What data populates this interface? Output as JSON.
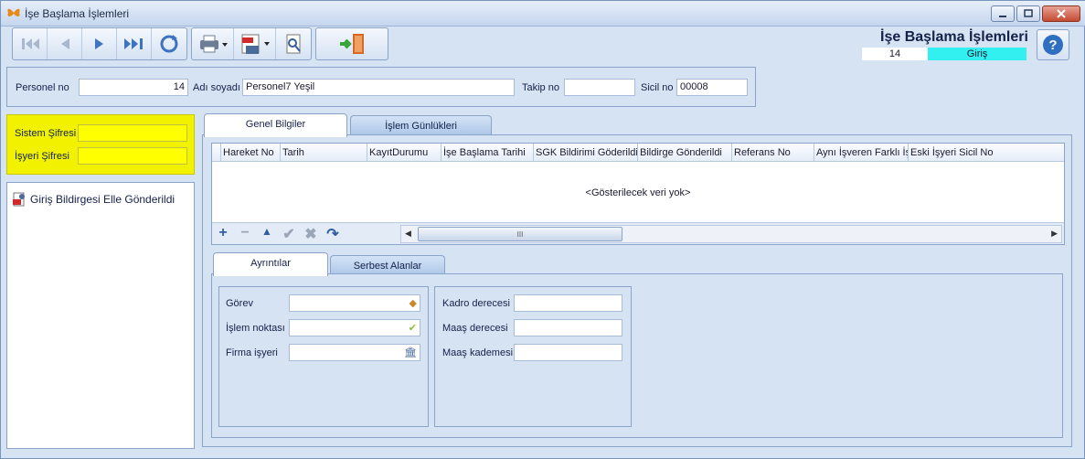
{
  "window": {
    "title": "İşe Başlama İşlemleri"
  },
  "header": {
    "title": "İşe Başlama İşlemleri",
    "record_no": "14",
    "status": "Giriş"
  },
  "top_fields": {
    "personel_no_label": "Personel no",
    "personel_no_value": "14",
    "adi_soyadi_label": "Adı soyadı",
    "adi_soyadi_value": "Personel7 Yeşil",
    "takip_no_label": "Takip no",
    "takip_no_value": "",
    "sicil_no_label": "Sicil no",
    "sicil_no_value": "00008"
  },
  "passwords": {
    "sistem_label": "Sistem Şifresi",
    "isyeri_label": "İşyeri Şifresi"
  },
  "left_list": {
    "items": [
      "Giriş Bildirgesi Elle Gönderildi"
    ]
  },
  "tabs": {
    "genel": "Genel Bilgiler",
    "gunlukler": "İşlem Günlükleri"
  },
  "grid": {
    "columns": [
      "Hareket No",
      "Tarih",
      "KayıtDurumu",
      "İşe Başlama Tarihi",
      "SGK Bildirimi Göderildi",
      "Bildirge Gönderildi",
      "Referans No",
      "Aynı İşveren Farklı İş",
      "Eski İşyeri Sicil No"
    ],
    "empty_text": "<Gösterilecek veri yok>",
    "scroll_thumb": "III"
  },
  "subtabs": {
    "ayrintilar": "Ayrıntılar",
    "serbest": "Serbest Alanlar"
  },
  "details": {
    "gorev_label": "Görev",
    "islem_noktasi_label": "İşlem noktası",
    "firma_isyeri_label": "Firma işyeri",
    "kadro_label": "Kadro derecesi",
    "maas_derecesi_label": "Maaş derecesi",
    "maas_kademesi_label": "Maaş kademesi"
  },
  "colors": {
    "accent": "#14214a",
    "status_bg": "#33f0f0",
    "password_bg": "#ffff00"
  },
  "icons": [
    "app-butterfly-icon",
    "first-record-icon",
    "previous-record-icon",
    "next-record-icon",
    "last-record-icon",
    "refresh-icon",
    "print-icon",
    "pdf-save-icon",
    "search-icon",
    "exit-door-icon",
    "help-icon"
  ]
}
